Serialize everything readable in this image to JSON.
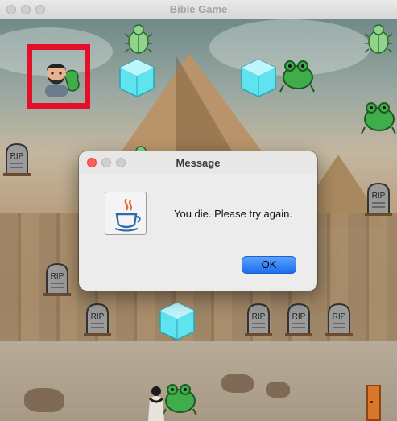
{
  "window": {
    "title": "Bible Game"
  },
  "game": {
    "tombstone_text": "RIP",
    "icons": {
      "player": "player-avatar-icon",
      "frog": "frog-icon",
      "ice": "ice-cube-icon",
      "beetle": "beetle-icon",
      "tombstone": "tombstone-icon",
      "door": "door-icon"
    },
    "colors": {
      "player_highlight": "#e3102a",
      "frog": "#3fae4a",
      "ice": "#5fe3ee",
      "beetle": "#8fd48c",
      "door": "#d9772c"
    }
  },
  "dialog": {
    "title": "Message",
    "message": "You die. Please try again.",
    "ok_label": "OK",
    "icon": "java-icon",
    "accent": "#1e6ef0"
  }
}
